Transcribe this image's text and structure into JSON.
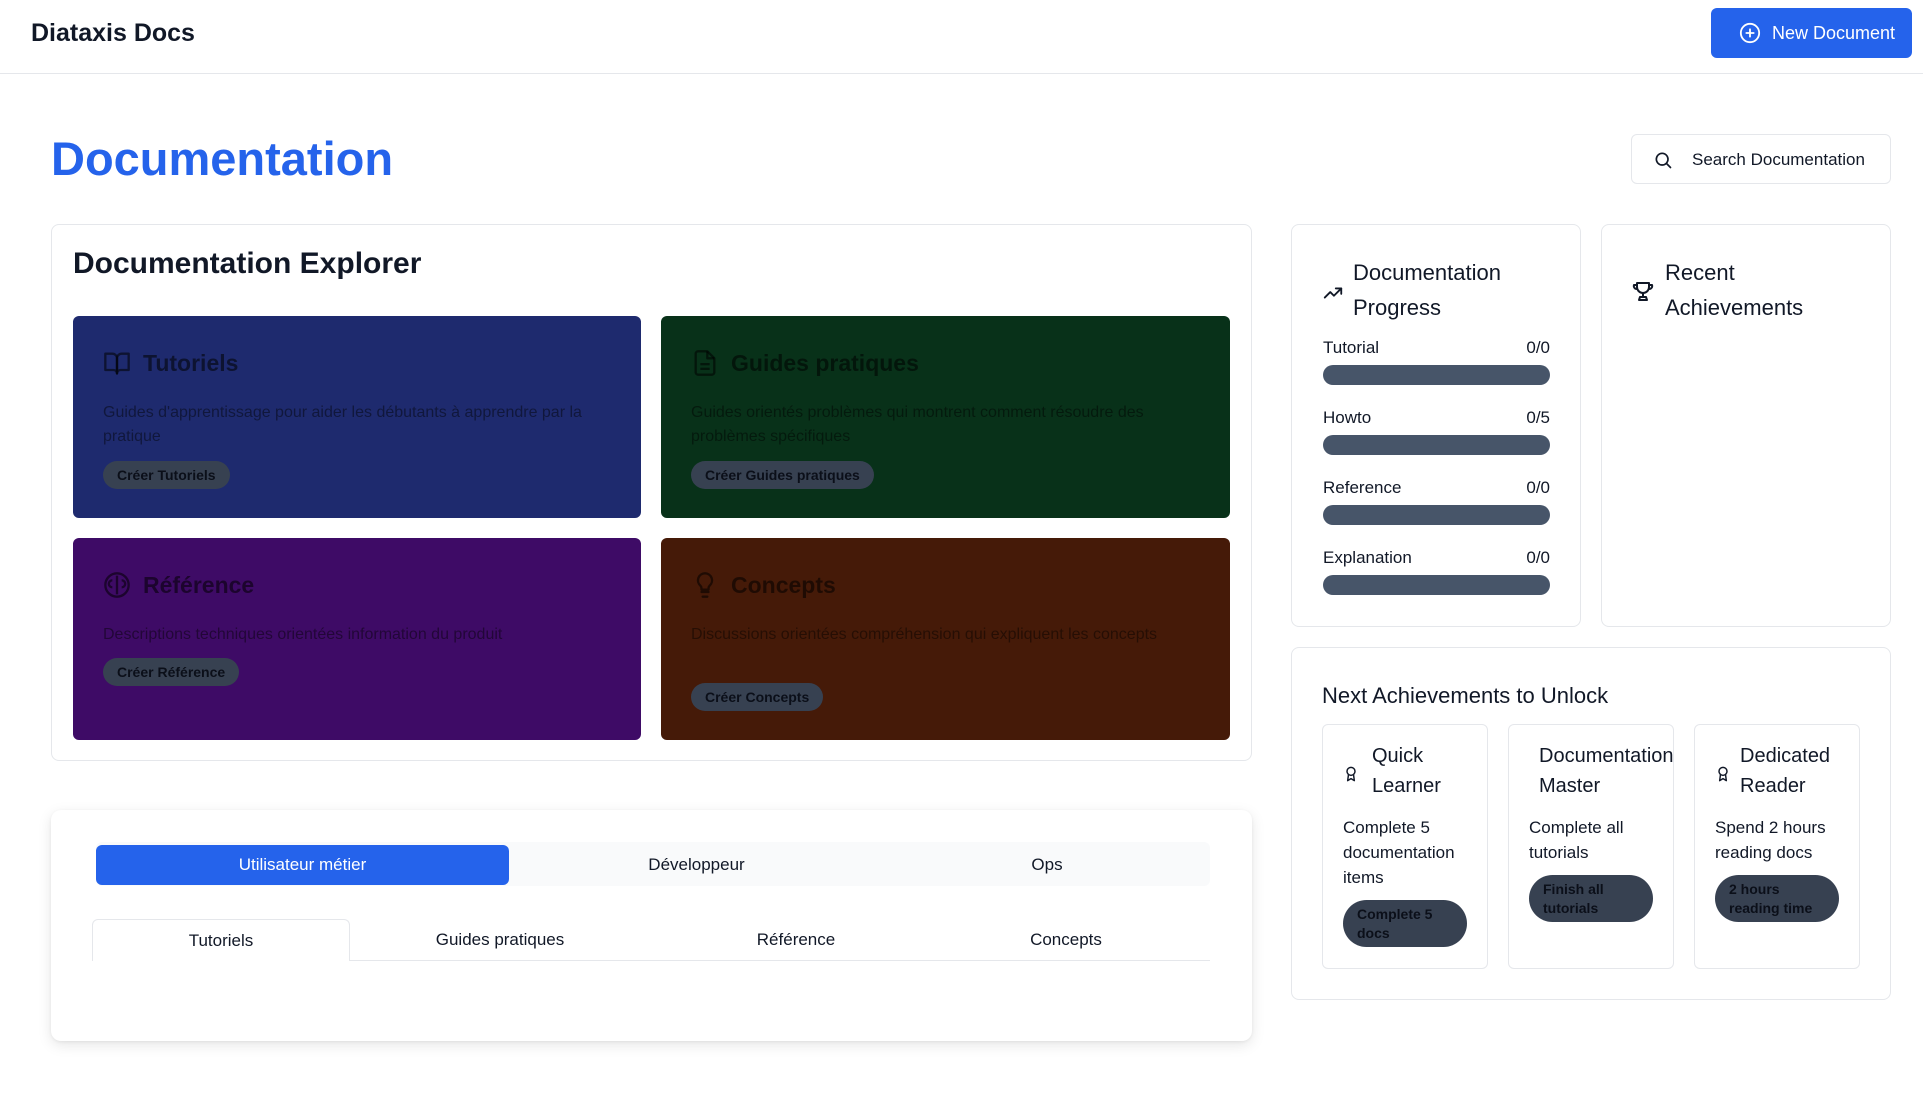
{
  "header": {
    "brand": "Diataxis Docs",
    "new_document_label": "New Document"
  },
  "page": {
    "title": "Documentation",
    "search_label": "Search Documentation"
  },
  "explorer": {
    "title": "Documentation Explorer",
    "tiles": [
      {
        "title": "Tutoriels",
        "description": "Guides d'apprentissage pour aider les débutants à apprendre par la pratique",
        "action": "Créer Tutoriels",
        "icon": "book-open-icon",
        "color": "#1e2a6e"
      },
      {
        "title": "Guides pratiques",
        "description": "Guides orientés problèmes qui montrent comment résoudre des problèmes spécifiques",
        "action": "Créer Guides pratiques",
        "icon": "file-text-icon",
        "color": "#083119"
      },
      {
        "title": "Référence",
        "description": "Descriptions techniques orientées information du produit",
        "action": "Créer Référence",
        "icon": "brain-icon",
        "color": "#3e0b66"
      },
      {
        "title": "Concepts",
        "description": "Discussions orientées compréhension qui expliquent les concepts",
        "action": "Créer Concepts",
        "icon": "lightbulb-icon",
        "color": "#451a08"
      }
    ]
  },
  "role_tabs": [
    "Utilisateur métier",
    "Développeur",
    "Ops"
  ],
  "doc_tabs": [
    "Tutoriels",
    "Guides pratiques",
    "Référence",
    "Concepts"
  ],
  "progress": {
    "title": "Documentation Progress",
    "items": [
      {
        "label": "Tutorial",
        "value": "0/0",
        "fraction": 0
      },
      {
        "label": "Howto",
        "value": "0/5",
        "fraction": 0
      },
      {
        "label": "Reference",
        "value": "0/0",
        "fraction": 0
      },
      {
        "label": "Explanation",
        "value": "0/0",
        "fraction": 0
      }
    ]
  },
  "recent": {
    "title": "Recent Achievements"
  },
  "next": {
    "title": "Next Achievements to Unlock",
    "items": [
      {
        "title": "Quick Learner",
        "description": "Complete 5 documentation items",
        "badge": "Complete 5 docs",
        "icon": "award-icon"
      },
      {
        "title": "Documentation Master",
        "description": "Complete all tutorials",
        "badge": "Finish all tutorials",
        "icon": "award-icon"
      },
      {
        "title": "Dedicated Reader",
        "description": "Spend 2 hours reading docs",
        "badge": "2 hours reading time",
        "icon": "award-icon"
      }
    ]
  }
}
